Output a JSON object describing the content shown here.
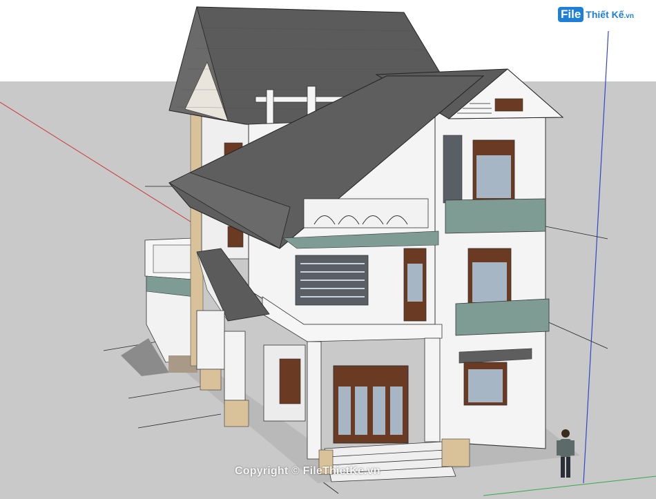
{
  "watermark": {
    "logo_mark": "File",
    "logo_text": "Thiết Kế",
    "logo_tld": ".vn",
    "copyright": "Copyright © FileThietKe.vn"
  },
  "colors": {
    "sky": "#ffffff",
    "ground": "#c9c9c9",
    "wall": "#f4f4f4",
    "roof": "#5b5b5b",
    "trim_green": "#7e9c93",
    "door_wood": "#6b3a22",
    "axis_red": "#cc3333",
    "axis_blue": "#3344cc",
    "stone": "#d9c29a"
  },
  "icons": [
    "logo-icon",
    "person-figure"
  ]
}
